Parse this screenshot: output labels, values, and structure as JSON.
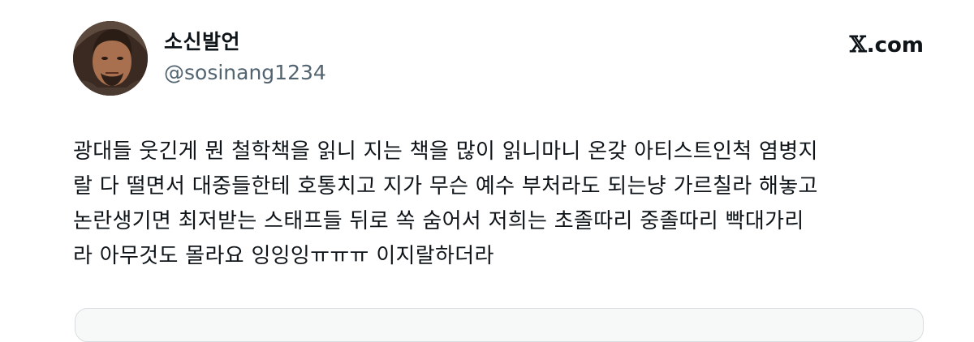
{
  "author": {
    "display_name": "소신발언",
    "handle": "@sosinang1234"
  },
  "brand": {
    "x_mark": "𝕏",
    "domain": ".com"
  },
  "tweet": {
    "lines": [
      "광대들 웃긴게 뭔 철학책을 읽니 지는 책을 많이 읽니마니 온갖 아티스트인척 염병지",
      "랄 다 떨면서 대중들한테 호통치고 지가 무슨 예수 부처라도 되는냥 가르칠라 해놓고",
      "논란생기면 최저받는 스태프들 뒤로 쏙 숨어서 저희는 초졸따리 중졸따리 빡대가리",
      "라 아무것도 몰라요 잉잉잉ㅠㅠㅠ 이지랄하더라"
    ]
  },
  "icons": {
    "avatar": "profile-photo",
    "brand": "x-logo"
  }
}
